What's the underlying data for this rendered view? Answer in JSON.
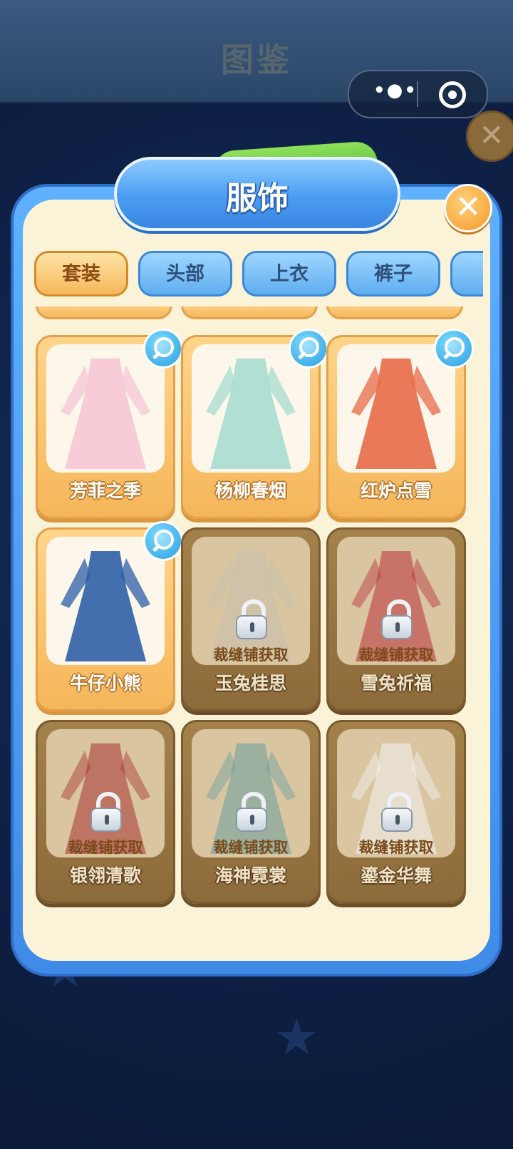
{
  "background": {
    "title": "图鉴"
  },
  "capsule": {
    "menu_icon": "more-dots-icon",
    "close_icon": "target-icon"
  },
  "modal": {
    "title": "服饰",
    "tabs": [
      {
        "label": "套装",
        "active": true
      },
      {
        "label": "头部",
        "active": false
      },
      {
        "label": "上衣",
        "active": false
      },
      {
        "label": "裤子",
        "active": false
      },
      {
        "label": "",
        "active": false
      }
    ],
    "items": [
      {
        "name": "芳菲之季",
        "locked": false,
        "hint": "",
        "color": "#f6c6d4"
      },
      {
        "name": "杨柳春烟",
        "locked": false,
        "hint": "",
        "color": "#a8dcd0"
      },
      {
        "name": "红炉点雪",
        "locked": false,
        "hint": "",
        "color": "#e86a4a"
      },
      {
        "name": "牛仔小熊",
        "locked": false,
        "hint": "",
        "color": "#2f5fa8"
      },
      {
        "name": "玉兔桂思",
        "locked": true,
        "hint": "裁缝铺获取",
        "color": "#c8bfae"
      },
      {
        "name": "雪兔祈福",
        "locked": true,
        "hint": "裁缝铺获取",
        "color": "#b8303a"
      },
      {
        "name": "银翎清歌",
        "locked": true,
        "hint": "裁缝铺获取",
        "color": "#a8322f"
      },
      {
        "name": "海神霓裳",
        "locked": true,
        "hint": "裁缝铺获取",
        "color": "#6a9ea0"
      },
      {
        "name": "鎏金华舞",
        "locked": true,
        "hint": "裁缝铺获取",
        "color": "#f2f2f2"
      }
    ]
  }
}
